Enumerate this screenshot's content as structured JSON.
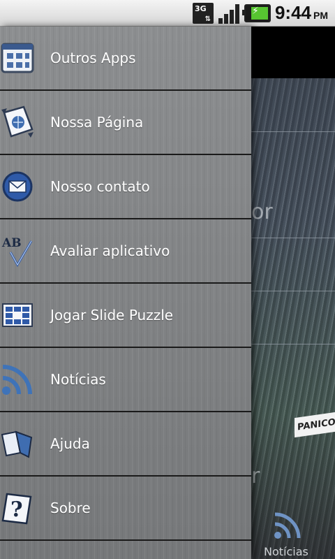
{
  "status_bar": {
    "network_type": "3G",
    "time": "9:44",
    "ampm": "PM"
  },
  "menu": {
    "items": [
      {
        "label": "Outros Apps",
        "icon": "apps-grid-icon"
      },
      {
        "label": "Nossa Página",
        "icon": "globe-page-icon"
      },
      {
        "label": "Nosso contato",
        "icon": "mail-icon"
      },
      {
        "label": "Avaliar aplicativo",
        "icon": "rate-check-icon"
      },
      {
        "label": "Jogar Slide Puzzle",
        "icon": "puzzle-grid-icon"
      },
      {
        "label": "Notícias",
        "icon": "rss-icon"
      },
      {
        "label": "Ajuda",
        "icon": "book-icon"
      },
      {
        "label": "Sobre",
        "icon": "question-icon"
      }
    ]
  },
  "background_app": {
    "partial_text_1": "or",
    "partial_text_2": "r",
    "banner_text": "PANICO",
    "tab_label": "Notícias"
  },
  "colors": {
    "accent_mail": "#2f5aa8",
    "rss_blue": "#3f73b8",
    "battery_green": "#57c531"
  }
}
